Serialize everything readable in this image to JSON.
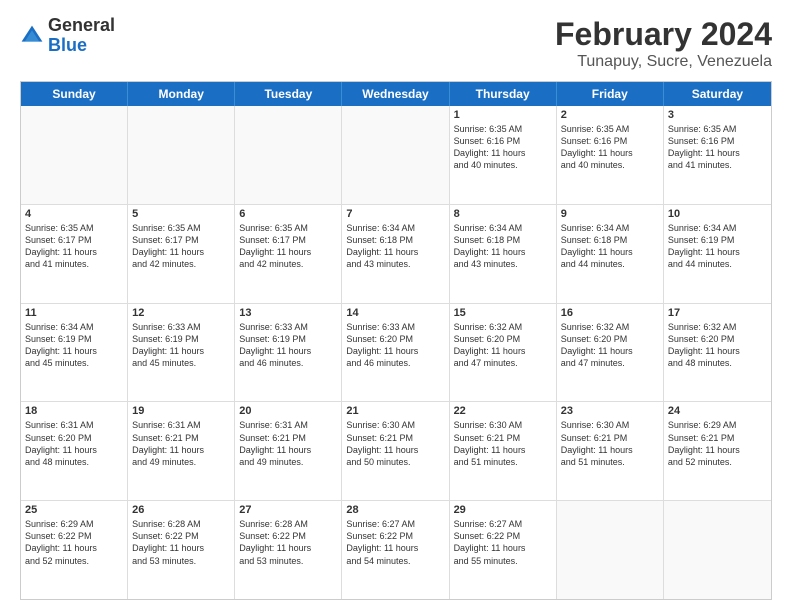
{
  "logo": {
    "general": "General",
    "blue": "Blue"
  },
  "header": {
    "title": "February 2024",
    "subtitle": "Tunapuy, Sucre, Venezuela"
  },
  "calendar": {
    "days": [
      "Sunday",
      "Monday",
      "Tuesday",
      "Wednesday",
      "Thursday",
      "Friday",
      "Saturday"
    ],
    "rows": [
      [
        {
          "day": "",
          "info": ""
        },
        {
          "day": "",
          "info": ""
        },
        {
          "day": "",
          "info": ""
        },
        {
          "day": "",
          "info": ""
        },
        {
          "day": "1",
          "info": "Sunrise: 6:35 AM\nSunset: 6:16 PM\nDaylight: 11 hours\nand 40 minutes."
        },
        {
          "day": "2",
          "info": "Sunrise: 6:35 AM\nSunset: 6:16 PM\nDaylight: 11 hours\nand 40 minutes."
        },
        {
          "day": "3",
          "info": "Sunrise: 6:35 AM\nSunset: 6:16 PM\nDaylight: 11 hours\nand 41 minutes."
        }
      ],
      [
        {
          "day": "4",
          "info": "Sunrise: 6:35 AM\nSunset: 6:17 PM\nDaylight: 11 hours\nand 41 minutes."
        },
        {
          "day": "5",
          "info": "Sunrise: 6:35 AM\nSunset: 6:17 PM\nDaylight: 11 hours\nand 42 minutes."
        },
        {
          "day": "6",
          "info": "Sunrise: 6:35 AM\nSunset: 6:17 PM\nDaylight: 11 hours\nand 42 minutes."
        },
        {
          "day": "7",
          "info": "Sunrise: 6:34 AM\nSunset: 6:18 PM\nDaylight: 11 hours\nand 43 minutes."
        },
        {
          "day": "8",
          "info": "Sunrise: 6:34 AM\nSunset: 6:18 PM\nDaylight: 11 hours\nand 43 minutes."
        },
        {
          "day": "9",
          "info": "Sunrise: 6:34 AM\nSunset: 6:18 PM\nDaylight: 11 hours\nand 44 minutes."
        },
        {
          "day": "10",
          "info": "Sunrise: 6:34 AM\nSunset: 6:19 PM\nDaylight: 11 hours\nand 44 minutes."
        }
      ],
      [
        {
          "day": "11",
          "info": "Sunrise: 6:34 AM\nSunset: 6:19 PM\nDaylight: 11 hours\nand 45 minutes."
        },
        {
          "day": "12",
          "info": "Sunrise: 6:33 AM\nSunset: 6:19 PM\nDaylight: 11 hours\nand 45 minutes."
        },
        {
          "day": "13",
          "info": "Sunrise: 6:33 AM\nSunset: 6:19 PM\nDaylight: 11 hours\nand 46 minutes."
        },
        {
          "day": "14",
          "info": "Sunrise: 6:33 AM\nSunset: 6:20 PM\nDaylight: 11 hours\nand 46 minutes."
        },
        {
          "day": "15",
          "info": "Sunrise: 6:32 AM\nSunset: 6:20 PM\nDaylight: 11 hours\nand 47 minutes."
        },
        {
          "day": "16",
          "info": "Sunrise: 6:32 AM\nSunset: 6:20 PM\nDaylight: 11 hours\nand 47 minutes."
        },
        {
          "day": "17",
          "info": "Sunrise: 6:32 AM\nSunset: 6:20 PM\nDaylight: 11 hours\nand 48 minutes."
        }
      ],
      [
        {
          "day": "18",
          "info": "Sunrise: 6:31 AM\nSunset: 6:20 PM\nDaylight: 11 hours\nand 48 minutes."
        },
        {
          "day": "19",
          "info": "Sunrise: 6:31 AM\nSunset: 6:21 PM\nDaylight: 11 hours\nand 49 minutes."
        },
        {
          "day": "20",
          "info": "Sunrise: 6:31 AM\nSunset: 6:21 PM\nDaylight: 11 hours\nand 49 minutes."
        },
        {
          "day": "21",
          "info": "Sunrise: 6:30 AM\nSunset: 6:21 PM\nDaylight: 11 hours\nand 50 minutes."
        },
        {
          "day": "22",
          "info": "Sunrise: 6:30 AM\nSunset: 6:21 PM\nDaylight: 11 hours\nand 51 minutes."
        },
        {
          "day": "23",
          "info": "Sunrise: 6:30 AM\nSunset: 6:21 PM\nDaylight: 11 hours\nand 51 minutes."
        },
        {
          "day": "24",
          "info": "Sunrise: 6:29 AM\nSunset: 6:21 PM\nDaylight: 11 hours\nand 52 minutes."
        }
      ],
      [
        {
          "day": "25",
          "info": "Sunrise: 6:29 AM\nSunset: 6:22 PM\nDaylight: 11 hours\nand 52 minutes."
        },
        {
          "day": "26",
          "info": "Sunrise: 6:28 AM\nSunset: 6:22 PM\nDaylight: 11 hours\nand 53 minutes."
        },
        {
          "day": "27",
          "info": "Sunrise: 6:28 AM\nSunset: 6:22 PM\nDaylight: 11 hours\nand 53 minutes."
        },
        {
          "day": "28",
          "info": "Sunrise: 6:27 AM\nSunset: 6:22 PM\nDaylight: 11 hours\nand 54 minutes."
        },
        {
          "day": "29",
          "info": "Sunrise: 6:27 AM\nSunset: 6:22 PM\nDaylight: 11 hours\nand 55 minutes."
        },
        {
          "day": "",
          "info": ""
        },
        {
          "day": "",
          "info": ""
        }
      ]
    ]
  }
}
